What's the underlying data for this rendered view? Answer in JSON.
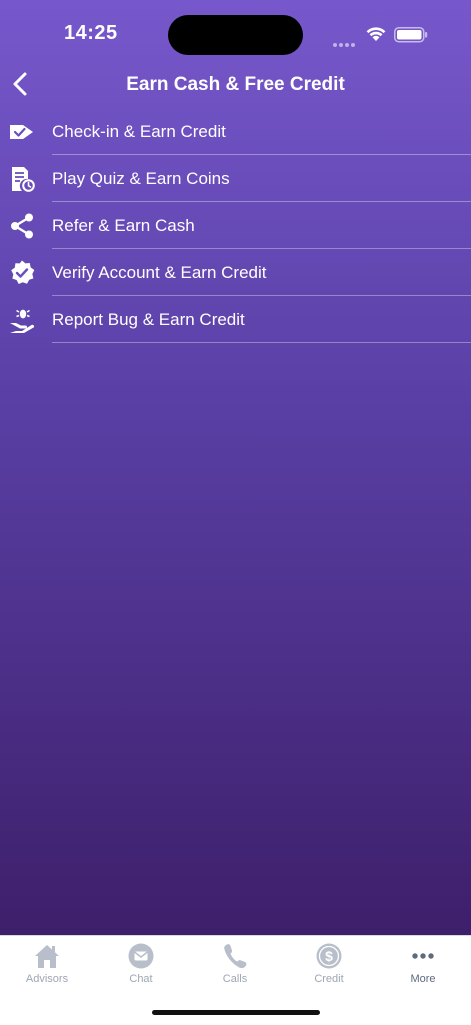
{
  "status_bar": {
    "time": "14:25"
  },
  "nav": {
    "title": "Earn Cash & Free Credit"
  },
  "menu": {
    "items": [
      {
        "label": "Check-in & Earn Credit",
        "icon": "check-in-arrow-icon"
      },
      {
        "label": "Play Quiz & Earn Coins",
        "icon": "quiz-document-icon"
      },
      {
        "label": "Refer & Earn Cash",
        "icon": "share-icon"
      },
      {
        "label": "Verify Account & Earn Credit",
        "icon": "verified-badge-icon"
      },
      {
        "label": "Report Bug & Earn Credit",
        "icon": "hand-bug-icon"
      }
    ]
  },
  "tab_bar": {
    "tabs": [
      {
        "label": "Advisors",
        "icon": "home-icon",
        "active": false
      },
      {
        "label": "Chat",
        "icon": "chat-icon",
        "active": false
      },
      {
        "label": "Calls",
        "icon": "phone-icon",
        "active": false
      },
      {
        "label": "Credit",
        "icon": "dollar-coin-icon",
        "active": false
      },
      {
        "label": "More",
        "icon": "more-dots-icon",
        "active": true
      }
    ]
  },
  "colors": {
    "gradient_top": "#7758cc",
    "gradient_bottom": "#3e1f6b",
    "tab_inactive": "#9ea6b2",
    "tab_active": "#5e6b7c"
  }
}
